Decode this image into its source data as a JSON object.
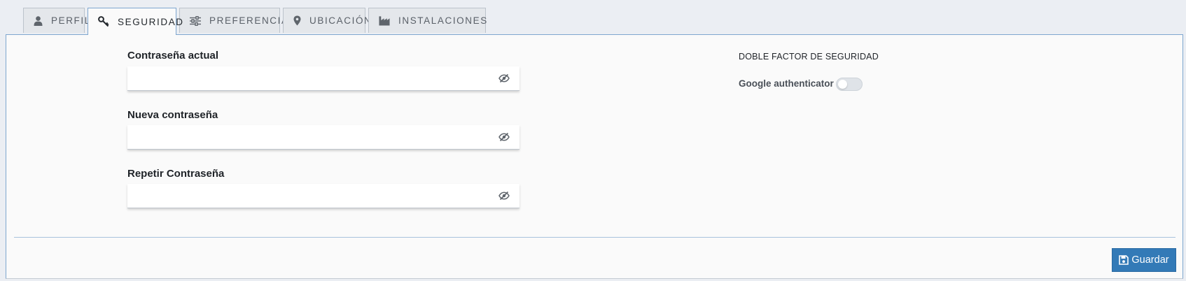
{
  "tabs": [
    {
      "label": "PERFIL",
      "icon": "user-icon"
    },
    {
      "label": "SEGURIDAD",
      "icon": "key-icon",
      "active": true
    },
    {
      "label": "PREFERENCIAS",
      "icon": "sliders-icon"
    },
    {
      "label": "UBICACIÓN",
      "icon": "map-pin-icon"
    },
    {
      "label": "INSTALACIONES",
      "icon": "factory-icon"
    }
  ],
  "form": {
    "current_password": {
      "label": "Contraseña actual",
      "value": "",
      "icon": "eye-slash-icon"
    },
    "new_password": {
      "label": "Nueva contraseña",
      "value": "",
      "icon": "eye-slash-icon"
    },
    "repeat_password": {
      "label": "Repetir Contraseña",
      "value": "",
      "icon": "eye-slash-icon"
    }
  },
  "mfa": {
    "title": "DOBLE FACTOR DE SEGURIDAD",
    "google_label": "Google authenticator",
    "google_enabled": false
  },
  "actions": {
    "save_label": "Guardar",
    "save_icon": "floppy-disk-icon"
  },
  "colors": {
    "accent": "#337ab7",
    "active_tab_border": "#7ea6cf",
    "background": "#ebeef3",
    "panel": "#fafafa"
  }
}
